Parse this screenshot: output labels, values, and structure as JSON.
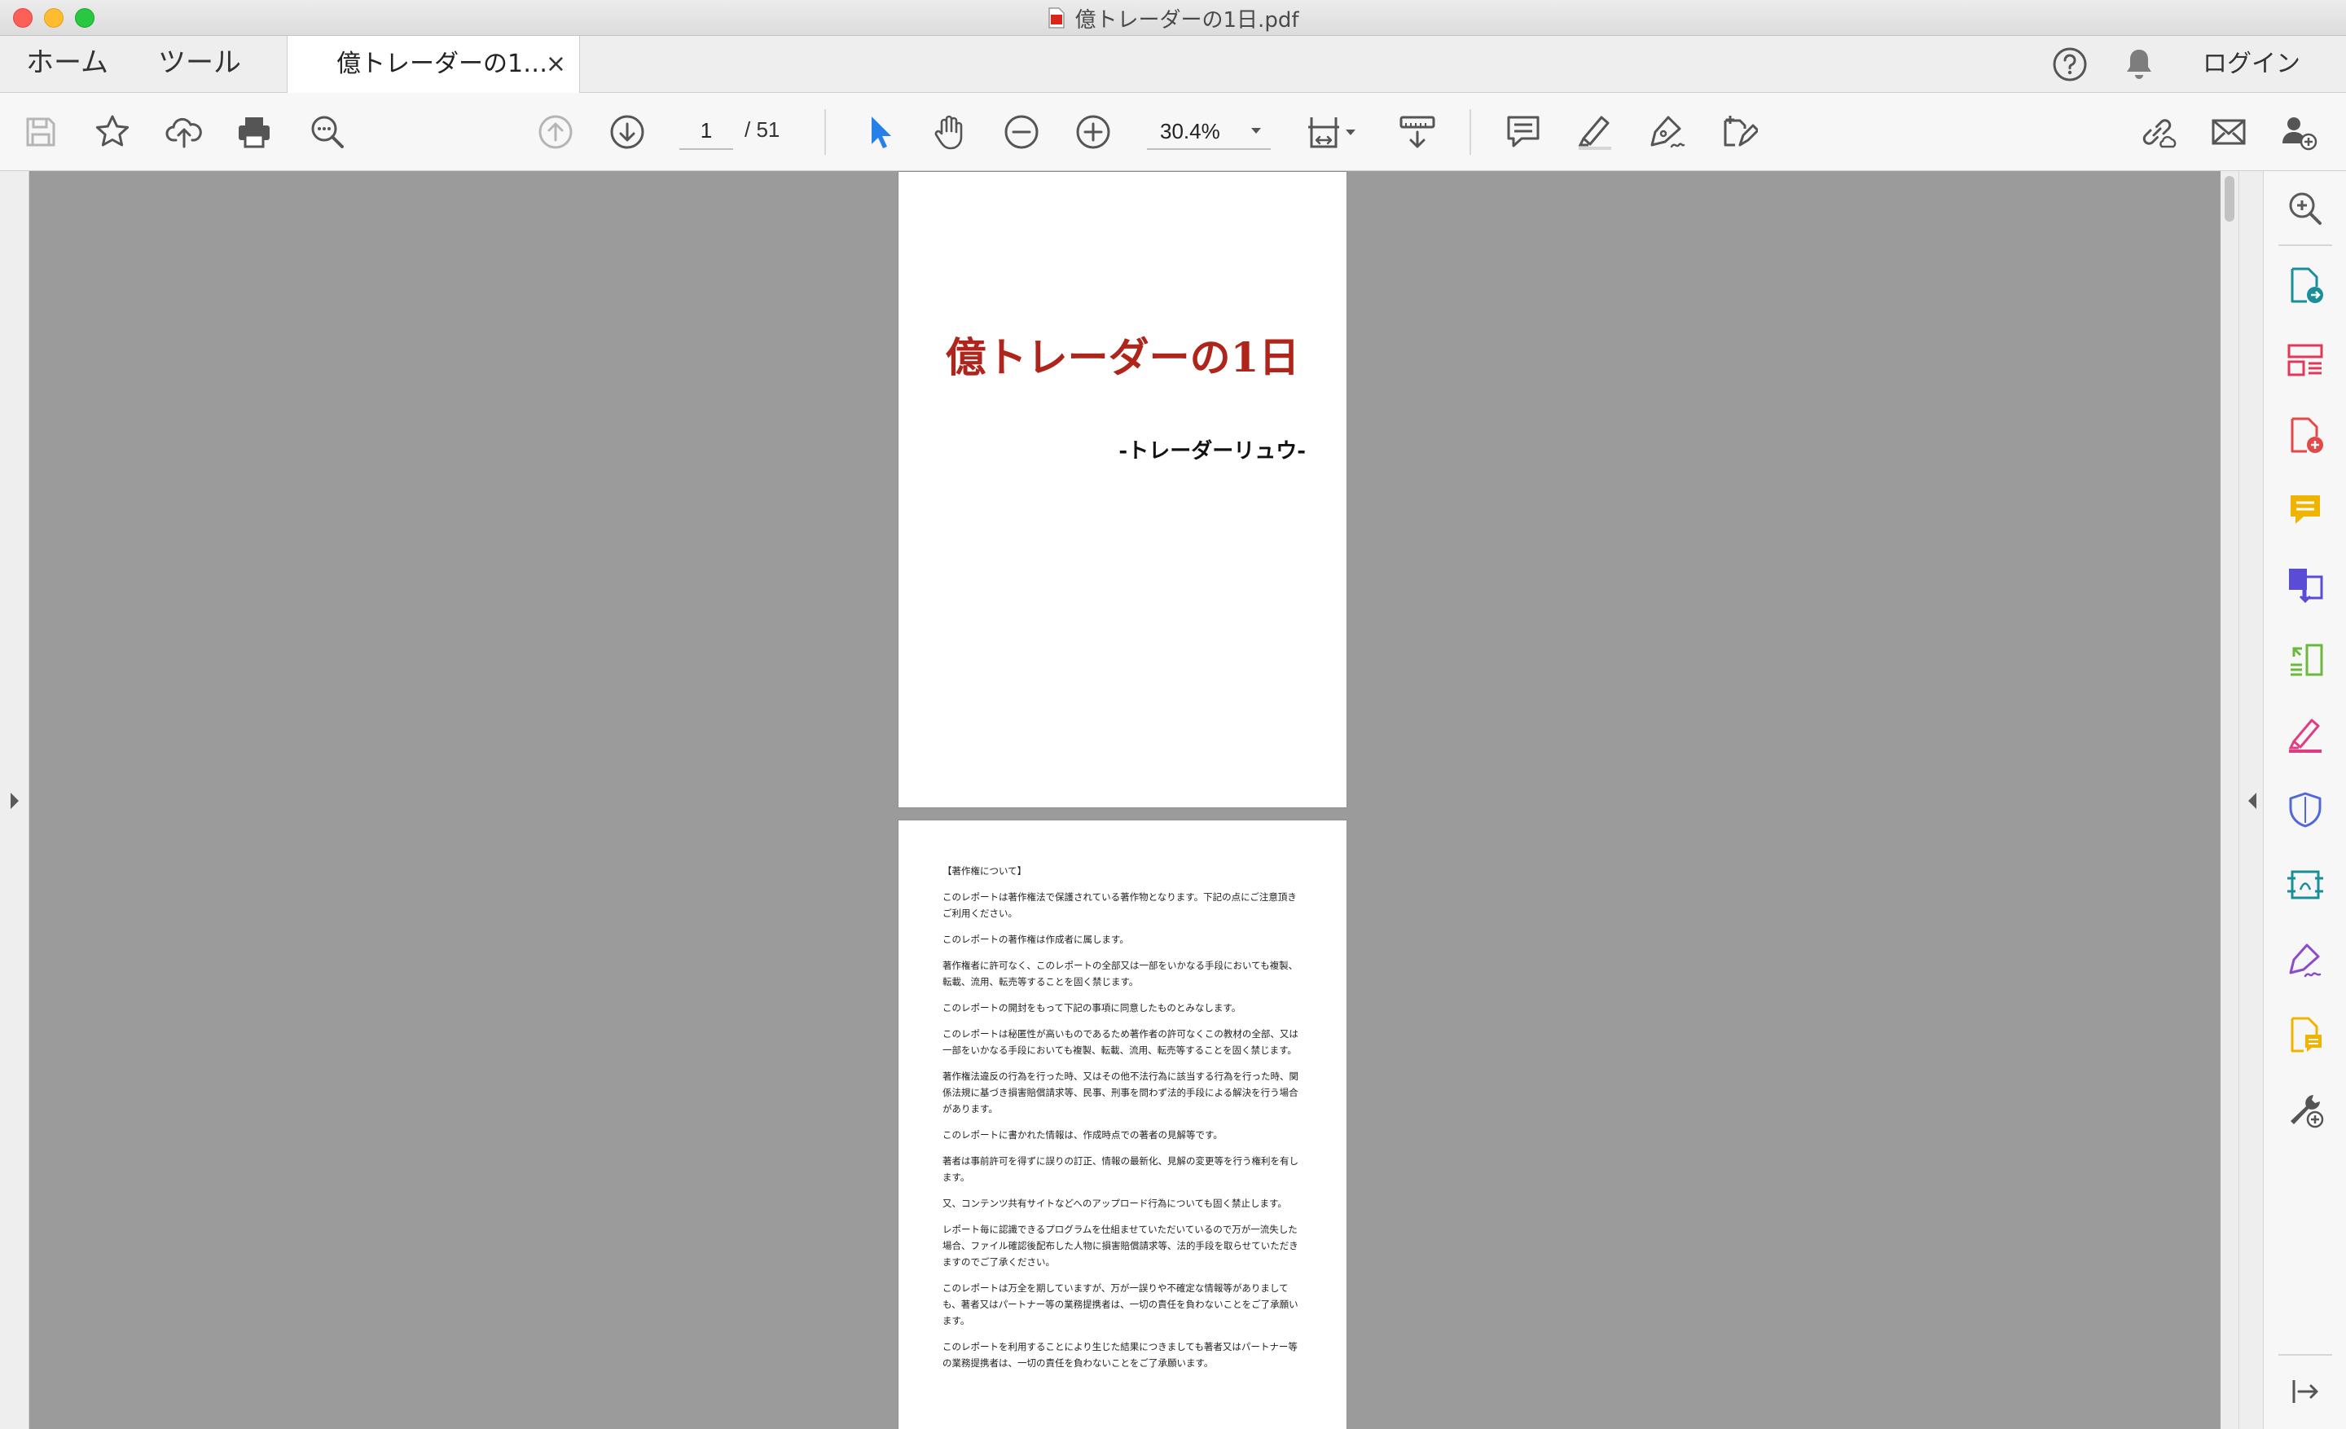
{
  "window": {
    "title": "億トレーダーの1日.pdf"
  },
  "tabs": {
    "home": "ホーム",
    "tools": "ツール",
    "document": "億トレーダーの1…",
    "close_symbol": "×",
    "login": "ログイン"
  },
  "toolbar": {
    "left_icons": [
      "save-icon",
      "bookmark-star-icon",
      "cloud-upload-icon",
      "print-icon",
      "search-zoom-icon"
    ],
    "page_current": "1",
    "page_total": "/  51",
    "zoom": "30.4%",
    "right_icons": [
      "select-arrow-icon",
      "hand-icon",
      "zoom-out-icon",
      "zoom-in-icon",
      "fit-page-icon",
      "scroll-mode-icon",
      "comment-icon",
      "highlight-icon",
      "sign-pen-icon",
      "fill-sign-icon",
      "share-link-icon",
      "mail-icon",
      "add-user-icon"
    ]
  },
  "right_panel": {
    "icons": [
      "search-zoom-icon",
      "export-pdf-icon",
      "organize-pages-icon",
      "create-pdf-icon",
      "comment-icon",
      "combine-files-icon",
      "organize-icon",
      "redact-icon",
      "protect-icon",
      "compress-icon",
      "fill-sign-icon",
      "send-for-review-icon",
      "more-tools-icon",
      "collapse-panel-icon"
    ],
    "colors": {
      "search": "#5a5a5a",
      "export": "#1a8f9a",
      "organize_pages": "#e0385a",
      "create": "#e44848",
      "comment": "#f0b400",
      "combine": "#5b4cd6",
      "organize": "#6ab93d",
      "redact": "#e03c82",
      "protect": "#5068d8",
      "compress": "#1a8f9a",
      "sign": "#8a4cc8",
      "review": "#f0b400",
      "tools": "#555555"
    }
  },
  "document": {
    "page1": {
      "title": "億トレーダーの1日",
      "author": "-トレーダーリュウ-"
    },
    "page2": {
      "heading": "【著作権について】",
      "paragraphs": [
        "このレポートは著作権法で保護されている著作物となります。下記の点にご注意頂きご利用ください。",
        "このレポートの著作権は作成者に属します。",
        "著作権者に許可なく、このレポートの全部又は一部をいかなる手段においても複製、転載、流用、転売等することを固く禁じます。",
        "このレポートの開封をもって下記の事項に同意したものとみなします。",
        "このレポートは秘匿性が高いものであるため著作者の許可なくこの教材の全部、又は一部をいかなる手段においても複製、転載、流用、転売等することを固く禁じます。",
        "著作権法違反の行為を行った時、又はその他不法行為に該当する行為を行った時、関係法規に基づき損害賠償請求等、民事、刑事を問わず法的手段による解決を行う場合があります。",
        "このレポートに書かれた情報は、作成時点での著者の見解等です。",
        "著者は事前許可を得ずに誤りの訂正、情報の最新化、見解の変更等を行う権利を有します。",
        "又、コンテンツ共有サイトなどへのアップロード行為についても固く禁止します。",
        "レポート毎に認識できるプログラムを仕組ませていただいているので万が一流失した場合、ファイル確認後配布した人物に損害賠償請求等、法的手段を取らせていただきますのでご了承ください。",
        "このレポートは万全を期していますが、万が一誤りや不確定な情報等がありましても、著者又はパートナー等の業務提携者は、一切の責任を負わないことをご了承願います。",
        "このレポートを利用することにより生じた結果につきましても著者又はパートナー等の業務提携者は、一切の責任を負わないことをご了承願います。"
      ]
    }
  }
}
